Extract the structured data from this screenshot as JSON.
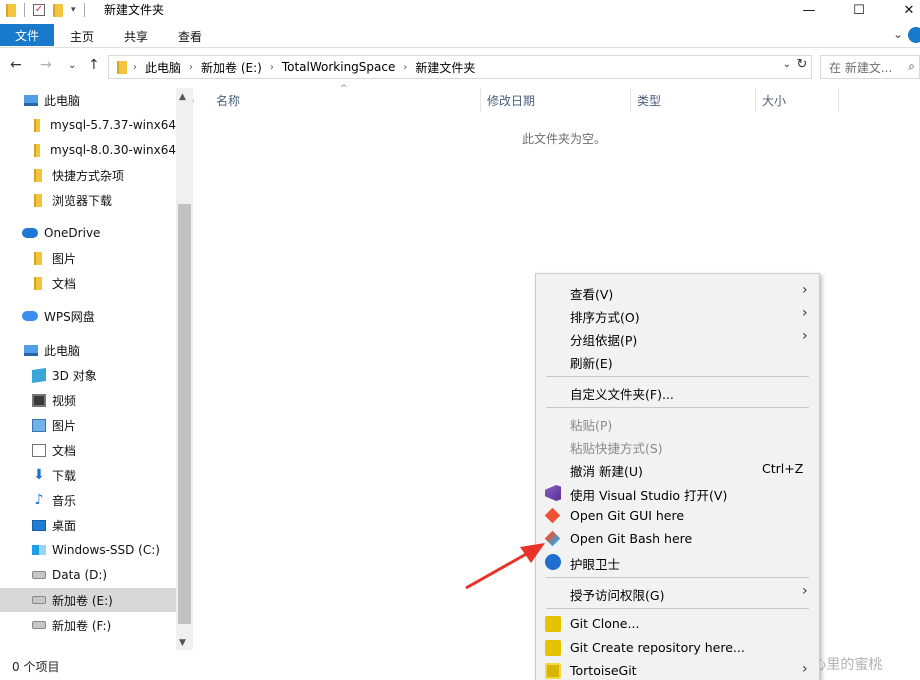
{
  "window": {
    "title": "新建文件夹",
    "controls": {
      "minimize": "—",
      "maximize": "☐",
      "close": "✕"
    }
  },
  "ribbon": {
    "tabs": [
      "文件",
      "主页",
      "共享",
      "查看"
    ]
  },
  "address": {
    "breadcrumbs": [
      "此电脑",
      "新加卷 (E:)",
      "TotalWorkingSpace",
      "新建文件夹"
    ],
    "search_placeholder": "在 新建文..."
  },
  "sidebar": {
    "items": [
      {
        "label": "此电脑",
        "icon": "computer-icon",
        "pinned": true
      },
      {
        "label": "mysql-5.7.37-winx64",
        "icon": "folder-icon"
      },
      {
        "label": "mysql-8.0.30-winx64",
        "icon": "folder-icon"
      },
      {
        "label": "快捷方式杂项",
        "icon": "folder-icon"
      },
      {
        "label": "浏览器下载",
        "icon": "folder-icon"
      },
      {
        "label": "OneDrive",
        "icon": "onedrive-icon"
      },
      {
        "label": "图片",
        "icon": "folder-icon"
      },
      {
        "label": "文档",
        "icon": "folder-icon"
      },
      {
        "label": "WPS网盘",
        "icon": "wps-cloud-icon"
      },
      {
        "label": "此电脑",
        "icon": "computer-icon"
      },
      {
        "label": "3D 对象",
        "icon": "3d-objects-icon"
      },
      {
        "label": "视频",
        "icon": "video-icon"
      },
      {
        "label": "图片",
        "icon": "pictures-icon"
      },
      {
        "label": "文档",
        "icon": "documents-icon"
      },
      {
        "label": "下载",
        "icon": "download-icon"
      },
      {
        "label": "音乐",
        "icon": "music-icon"
      },
      {
        "label": "桌面",
        "icon": "desktop-icon"
      },
      {
        "label": "Windows-SSD (C:)",
        "icon": "windows-drive-icon"
      },
      {
        "label": "Data (D:)",
        "icon": "drive-icon"
      },
      {
        "label": "新加卷 (E:)",
        "icon": "drive-icon",
        "selected": true
      },
      {
        "label": "新加卷 (F:)",
        "icon": "drive-icon"
      }
    ]
  },
  "content": {
    "columns": [
      "名称",
      "修改日期",
      "类型",
      "大小"
    ],
    "empty_message": "此文件夹为空。"
  },
  "context_menu": {
    "items": [
      {
        "label": "查看(V)",
        "submenu": true
      },
      {
        "label": "排序方式(O)",
        "submenu": true
      },
      {
        "label": "分组依据(P)",
        "submenu": true
      },
      {
        "label": "刷新(E)"
      },
      {
        "label": "自定义文件夹(F)..."
      },
      {
        "label": "粘贴(P)",
        "disabled": true
      },
      {
        "label": "粘贴快捷方式(S)",
        "disabled": true
      },
      {
        "label": "撤消 新建(U)",
        "shortcut": "Ctrl+Z"
      },
      {
        "label": "使用 Visual Studio 打开(V)",
        "icon": "visual-studio-icon"
      },
      {
        "label": "Open Git GUI here",
        "icon": "git-gui-icon"
      },
      {
        "label": "Open Git Bash here",
        "icon": "git-bash-icon"
      },
      {
        "label": "护眼卫士",
        "icon": "eye-guard-icon"
      },
      {
        "label": "授予访问权限(G)",
        "submenu": true
      },
      {
        "label": "Git Clone...",
        "icon": "tortoisegit-clone-icon"
      },
      {
        "label": "Git Create repository here...",
        "icon": "tortoisegit-create-icon"
      },
      {
        "label": "TortoiseGit",
        "icon": "tortoisegit-icon",
        "submenu": true
      }
    ]
  },
  "status": {
    "item_count": "0 个项目"
  },
  "watermark": "CSDN @甜到心里的蜜桃",
  "colors": {
    "accent": "#1979ca",
    "selected_bg": "#d9d9d9",
    "menu_bg": "#f2f2f2",
    "annotation_arrow": "#e8322a"
  }
}
